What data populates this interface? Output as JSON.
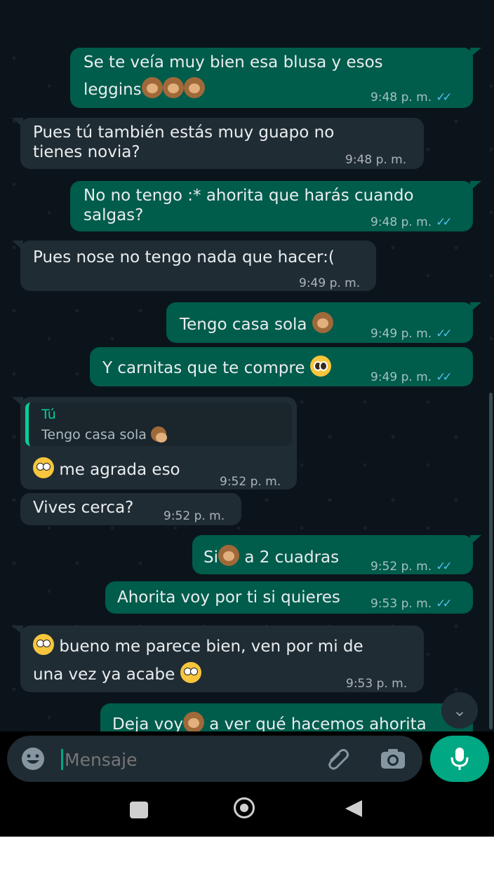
{
  "messages": [
    {
      "dir": "out",
      "line1": "Se te veía muy bien esa blusa y esos",
      "line2": "leggins",
      "time": "9:48 p. m."
    },
    {
      "dir": "in",
      "line1": "Pues tú también estás muy guapo no",
      "line2": "tienes novia?",
      "time": "9:48 p. m."
    },
    {
      "dir": "out",
      "line1": "No no tengo :* ahorita que harás cuando",
      "line2": "salgas?",
      "time": "9:48 p. m."
    },
    {
      "dir": "in",
      "line1": "Pues nose no tengo nada que hacer:(",
      "time": "9:49 p. m."
    },
    {
      "dir": "out",
      "line1": "Tengo casa sola",
      "time": "9:49 p. m."
    },
    {
      "dir": "out",
      "line1": "Y carnitas que te compre",
      "time": "9:49 p. m."
    },
    {
      "dir": "in",
      "quote_name": "Tú",
      "quote_text": "Tengo casa sola",
      "line1": "me agrada eso",
      "time": "9:52 p. m."
    },
    {
      "dir": "in",
      "line1": "Vives cerca?",
      "time": "9:52 p. m."
    },
    {
      "dir": "out",
      "line1a": "Si",
      "line1b": "a 2 cuadras",
      "time": "9:52 p. m."
    },
    {
      "dir": "out",
      "line1": "Ahorita voy por ti si quieres",
      "time": "9:53 p. m."
    },
    {
      "dir": "in",
      "line1": "bueno me parece bien, ven por mi de",
      "line2": "una vez ya acabe",
      "time": "9:53 p. m."
    },
    {
      "dir": "out",
      "line1a": "Deja voy",
      "line1b": "a ver qué hacemos ahorita"
    }
  ],
  "input": {
    "placeholder": "Mensaje"
  },
  "icons": {
    "emoji": "emoji-icon",
    "attach": "paperclip-icon",
    "camera": "camera-icon",
    "mic": "mic-icon",
    "scroll": "chevron-down-icon"
  },
  "ticks": "✓✓",
  "colors": {
    "out_bubble": "#005c4b",
    "in_bubble": "#202c33",
    "accent": "#00a884",
    "read_ticks": "#53bdeb"
  }
}
